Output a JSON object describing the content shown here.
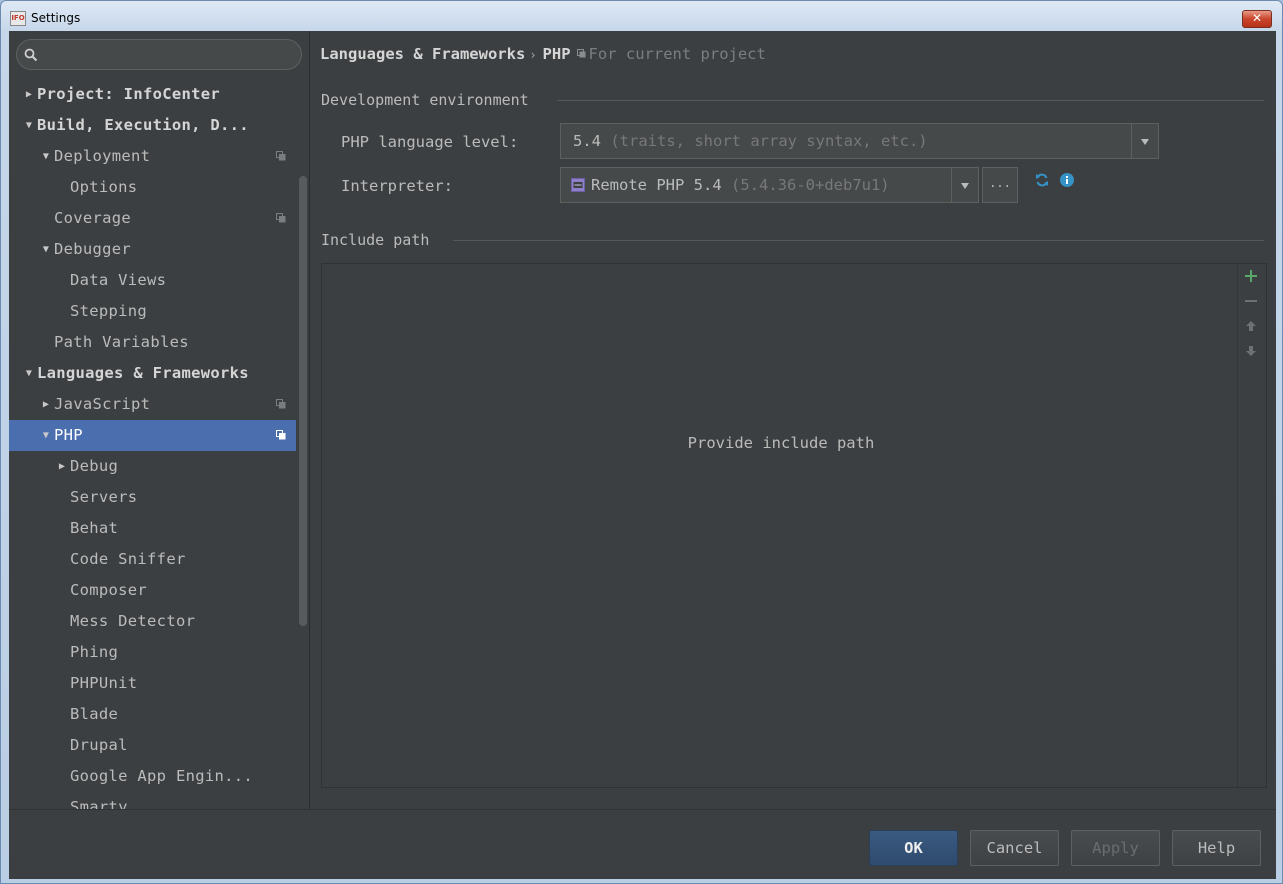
{
  "window": {
    "title": "Settings",
    "app_icon_text": "IFO",
    "close_glyph": "✕"
  },
  "search": {
    "value": "",
    "placeholder": ""
  },
  "sidebar": {
    "items": [
      {
        "label": "Project: InfoCenter",
        "bold": true,
        "arrow": "▶",
        "level": 0
      },
      {
        "label": "Build, Execution, D...",
        "bold": true,
        "arrow": "▼",
        "level": 0
      },
      {
        "label": "Deployment",
        "arrow": "▼",
        "level": 1,
        "copy_icon": true
      },
      {
        "label": "Options",
        "level": 2
      },
      {
        "label": "Coverage",
        "level": 1,
        "copy_icon": true
      },
      {
        "label": "Debugger",
        "arrow": "▼",
        "level": 1
      },
      {
        "label": "Data Views",
        "level": 2
      },
      {
        "label": "Stepping",
        "level": 2
      },
      {
        "label": "Path Variables",
        "level": 1
      },
      {
        "label": "Languages & Frameworks",
        "bold": true,
        "arrow": "▼",
        "level": 0
      },
      {
        "label": "JavaScript",
        "arrow": "▶",
        "level": 1,
        "copy_icon": true
      },
      {
        "label": "PHP",
        "arrow": "▼",
        "level": 1,
        "copy_icon": true,
        "selected": true
      },
      {
        "label": "Debug",
        "arrow": "▶",
        "level": 2
      },
      {
        "label": "Servers",
        "level": 2
      },
      {
        "label": "Behat",
        "level": 2
      },
      {
        "label": "Code Sniffer",
        "level": 2
      },
      {
        "label": "Composer",
        "level": 2
      },
      {
        "label": "Mess Detector",
        "level": 2
      },
      {
        "label": "Phing",
        "level": 2
      },
      {
        "label": "PHPUnit",
        "level": 2
      },
      {
        "label": "Blade",
        "level": 2
      },
      {
        "label": "Drupal",
        "level": 2
      },
      {
        "label": "Google App Engin...",
        "level": 2
      },
      {
        "label": "Smarty",
        "level": 2
      }
    ]
  },
  "breadcrumb": {
    "parent": "Languages & Frameworks",
    "separator": "›",
    "current": "PHP",
    "scope": "For current project"
  },
  "dev_env": {
    "section_title": "Development environment",
    "php_level_label": "PHP language level:",
    "php_level_value": "5.4",
    "php_level_hint": "(traits, short array syntax, etc.)",
    "interpreter_label": "Interpreter:",
    "interpreter_value": "Remote PHP 5.4",
    "interpreter_hint": "(5.4.36-0+deb7u1)",
    "browse_label": "..."
  },
  "include_path": {
    "section_title": "Include path",
    "empty_text": "Provide include path"
  },
  "footer": {
    "ok": "OK",
    "cancel": "Cancel",
    "apply": "Apply",
    "help": "Help"
  },
  "colors": {
    "selection": "#4b6eaf",
    "background": "#3c3f41",
    "add_icon": "#59a869",
    "refresh_icon": "#3592c4",
    "info_icon": "#3592c4"
  }
}
